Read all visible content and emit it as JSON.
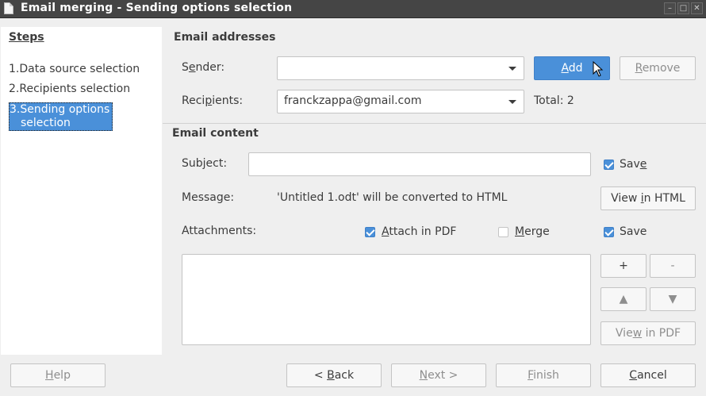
{
  "window": {
    "title": "Email merging - Sending options selection",
    "buttons": {
      "minimize": "–",
      "maximize": "□",
      "close": "✕"
    }
  },
  "sidebar": {
    "title": "Steps",
    "steps": [
      {
        "num": "1.",
        "label": "Data source selection"
      },
      {
        "num": "2.",
        "label": "Recipients selection"
      },
      {
        "num": "3.",
        "label_line1": "Sending options",
        "label_line2": "selection"
      }
    ]
  },
  "email_addresses": {
    "heading": "Email addresses",
    "sender_label_pre": "S",
    "sender_label_u": "e",
    "sender_label_post": "nder:",
    "sender_value": "",
    "add_pre": "",
    "add_u": "A",
    "add_post": "dd",
    "remove_pre": "",
    "remove_u": "R",
    "remove_post": "emove",
    "recipients_label_pre": "Reci",
    "recipients_label_u": "p",
    "recipients_label_post": "ients:",
    "recipients_value": "franckzappa@gmail.com",
    "total_label": "Total: 2"
  },
  "email_content": {
    "heading": "Email content",
    "subject_label": "Subject:",
    "subject_value": "",
    "save_pre": "Sav",
    "save_u": "e",
    "save_post": "",
    "message_label": "Message:",
    "message_text": "'Untitled 1.odt' will be converted to HTML",
    "view_html_pre": "View ",
    "view_html_u": "i",
    "view_html_post": "n HTML",
    "attachments_label": "Attachments:",
    "attach_pdf_pre": "",
    "attach_pdf_u": "A",
    "attach_pdf_post": "ttach in PDF",
    "merge_pre": "",
    "merge_u": "M",
    "merge_post": "erge",
    "att_save_label": "Save",
    "plus": "+",
    "minus": "-",
    "up": "▲",
    "down": "▼",
    "view_pdf_pre": "Vie",
    "view_pdf_u": "w",
    "view_pdf_post": " in PDF"
  },
  "footer": {
    "help_pre": "",
    "help_u": "H",
    "help_post": "elp",
    "back_pre": "< ",
    "back_u": "B",
    "back_post": "ack",
    "next_pre": "",
    "next_u": "N",
    "next_post": "ext >",
    "finish_pre": "",
    "finish_u": "F",
    "finish_post": "inish",
    "cancel_pre": "",
    "cancel_u": "C",
    "cancel_post": "ancel"
  },
  "colors": {
    "accent": "#4a90d9",
    "titlebar": "#454545",
    "panel": "#efefef"
  }
}
